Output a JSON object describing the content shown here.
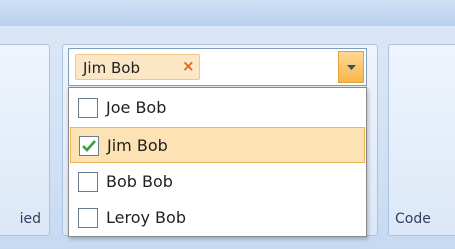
{
  "left_panel": {
    "label": "ied"
  },
  "right_panel": {
    "label": "Code"
  },
  "combo": {
    "selected_tokens": [
      {
        "label": "Jim Bob",
        "remove": "×"
      }
    ]
  },
  "dropdown": {
    "options": [
      {
        "label": "Joe Bob",
        "checked": false
      },
      {
        "label": "Jim Bob",
        "checked": true
      },
      {
        "label": "Bob Bob",
        "checked": false
      },
      {
        "label": "Leroy Bob",
        "checked": false
      }
    ]
  },
  "colors": {
    "accent_orange": "#f6b84a",
    "check_green": "#3a9b3a",
    "panel_blue": "#dce8f7"
  }
}
